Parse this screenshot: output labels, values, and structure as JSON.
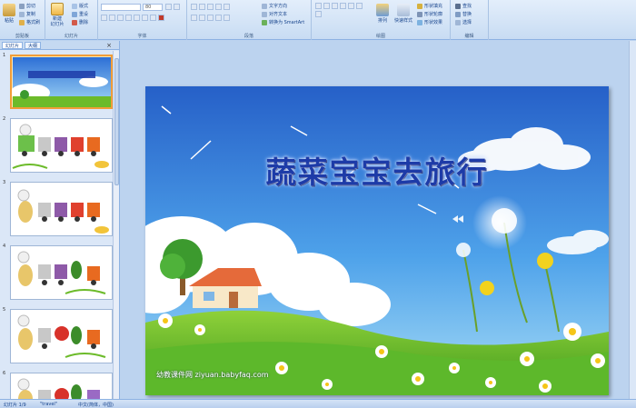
{
  "ribbon": {
    "clipboard": {
      "paste": "粘贴",
      "cut": "剪切",
      "copy": "复制",
      "format_painter": "格式刷",
      "label": "剪贴板"
    },
    "slides": {
      "new_slide": "新建\n幻灯片",
      "layout": "版式",
      "reset": "重设",
      "delete": "删除",
      "label": "幻灯片"
    },
    "font": {
      "font_name": "",
      "font_size": "80",
      "label": "字体"
    },
    "paragraph": {
      "text_direction": "文字方向",
      "align_text": "对齐文本",
      "smartart": "转换为 SmartArt",
      "label": "段落"
    },
    "drawing": {
      "arrange": "排列",
      "quick_styles": "快速样式",
      "shape_fill": "形状填充",
      "shape_outline": "形状轮廓",
      "shape_effects": "形状效果",
      "label": "绘图"
    },
    "editing": {
      "find": "查找",
      "replace": "替换",
      "select": "选择",
      "label": "编辑"
    }
  },
  "panel": {
    "tab_slides": "幻灯片",
    "tab_outline": "大纲",
    "close": "×",
    "thumbnails": [
      {
        "num": "1",
        "selected": true
      },
      {
        "num": "2",
        "selected": false
      },
      {
        "num": "3",
        "selected": false
      },
      {
        "num": "4",
        "selected": false
      },
      {
        "num": "5",
        "selected": false
      },
      {
        "num": "6",
        "selected": false
      }
    ]
  },
  "slide": {
    "title": "蔬菜宝宝去旅行",
    "watermark": "幼教课件网 ziyuan.babyfaq.com"
  },
  "status": {
    "slide_info": "幻灯片 1/9",
    "theme": "\"travel\"",
    "language": "中文(简体，中国)"
  },
  "colors": {
    "ribbon_bg": "#dbe7f7",
    "sky_top": "#2d6fd6",
    "sky_bottom": "#8fd2f5",
    "grass": "#6cbb2a",
    "title": "#1d3ba8",
    "selection": "#f29d38"
  }
}
